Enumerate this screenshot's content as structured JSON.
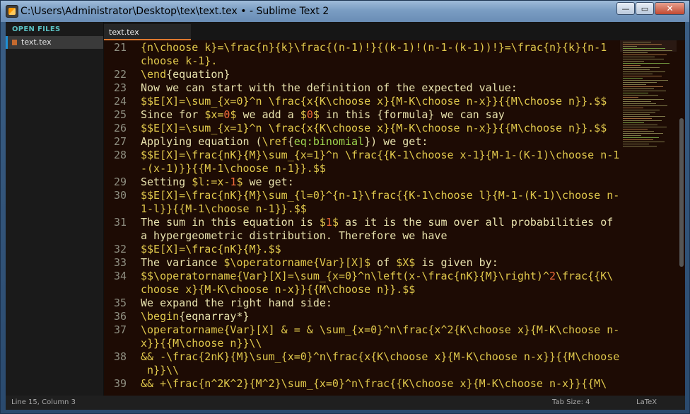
{
  "window": {
    "title": "C:\\Users\\Administrator\\Desktop\\tex\\text.tex • - Sublime Text 2",
    "buttons": {
      "minimize": "—",
      "maximize": "▭",
      "close": "✕"
    }
  },
  "sidebar": {
    "header": "OPEN FILES",
    "files": [
      {
        "name": "text.tex"
      }
    ]
  },
  "tabs": [
    {
      "label": "text.tex",
      "active": true
    }
  ],
  "status": {
    "position": "Line 15, Column 3",
    "tab_size": "Tab Size: 4",
    "syntax": "LaTeX"
  },
  "colors": {
    "editor_bg": "#1d0b04",
    "text": "#e8e2ad",
    "keyword": "#e0c84c",
    "number": "#f06a3a",
    "reference": "#9fd84f",
    "tab_accent": "#e0792f"
  },
  "editor": {
    "lines": [
      {
        "n": "21",
        "segments": [
          {
            "t": "{n\\choose k}=\\frac{n}{k}\\frac{(n-1)!}{(k-1)!(n-1-(k-1))!}=\\frac{n}{k}{n-1",
            "c": "y"
          }
        ]
      },
      {
        "n": "",
        "segments": [
          {
            "t": "choose k-1}.",
            "c": "y"
          }
        ]
      },
      {
        "n": "22",
        "segments": [
          {
            "t": "\\end",
            "c": "y"
          },
          {
            "t": "{equation}",
            "c": "c"
          }
        ]
      },
      {
        "n": "23",
        "segments": [
          {
            "t": "Now we can start with the definition of the expected value:",
            "c": "c"
          }
        ]
      },
      {
        "n": "24",
        "segments": [
          {
            "t": "$$E[X]=\\sum_{x=0}^n \\frac{x{K\\choose x}{M-K\\choose n-x}}{{M\\choose n}}.$$",
            "c": "y"
          }
        ]
      },
      {
        "n": "25",
        "segments": [
          {
            "t": "Since for ",
            "c": "c"
          },
          {
            "t": "$x=",
            "c": "y"
          },
          {
            "t": "0",
            "c": "r"
          },
          {
            "t": "$",
            "c": "y"
          },
          {
            "t": " we add a ",
            "c": "c"
          },
          {
            "t": "$",
            "c": "y"
          },
          {
            "t": "0",
            "c": "r"
          },
          {
            "t": "$",
            "c": "y"
          },
          {
            "t": " in this {formula} we can say",
            "c": "c"
          }
        ]
      },
      {
        "n": "26",
        "segments": [
          {
            "t": "$$E[X]=\\sum_{x=1}^n \\frac{x{K\\choose x}{M-K\\choose n-x}}{{M\\choose n}}.$$",
            "c": "y"
          }
        ]
      },
      {
        "n": "27",
        "segments": [
          {
            "t": "Applying equation (",
            "c": "c"
          },
          {
            "t": "\\ref",
            "c": "y"
          },
          {
            "t": "{",
            "c": "c"
          },
          {
            "t": "eq:binomial",
            "c": "g"
          },
          {
            "t": "}) we get:",
            "c": "c"
          }
        ]
      },
      {
        "n": "28",
        "segments": [
          {
            "t": "$$E[X]=\\frac{nK}{M}\\sum_{x=1}^n \\frac{{K-1\\choose x-1}{M-1-(K-1)\\choose n-1",
            "c": "y"
          }
        ]
      },
      {
        "n": "",
        "segments": [
          {
            "t": "-(x-1)}}{{M-1\\choose n-1}}.$$",
            "c": "y"
          }
        ]
      },
      {
        "n": "29",
        "segments": [
          {
            "t": "Setting ",
            "c": "c"
          },
          {
            "t": "$l:=x-",
            "c": "y"
          },
          {
            "t": "1",
            "c": "r"
          },
          {
            "t": "$",
            "c": "y"
          },
          {
            "t": " we get:",
            "c": "c"
          }
        ]
      },
      {
        "n": "30",
        "segments": [
          {
            "t": "$$E[X]=\\frac{nK}{M}\\sum_{l=0}^{n-1}\\frac{{K-1\\choose l}{M-1-(K-1)\\choose n-",
            "c": "y"
          }
        ]
      },
      {
        "n": "",
        "segments": [
          {
            "t": "1-l}}{{M-1\\choose n-1}}.$$",
            "c": "y"
          }
        ]
      },
      {
        "n": "31",
        "segments": [
          {
            "t": "The sum in this equation is ",
            "c": "c"
          },
          {
            "t": "$",
            "c": "y"
          },
          {
            "t": "1",
            "c": "r"
          },
          {
            "t": "$",
            "c": "y"
          },
          {
            "t": " as it is the sum over all probabilities of",
            "c": "c"
          }
        ]
      },
      {
        "n": "",
        "segments": [
          {
            "t": "a hypergeometric distribution. Therefore we have",
            "c": "c"
          }
        ]
      },
      {
        "n": "32",
        "segments": [
          {
            "t": "$$E[X]=\\frac{nK}{M}.$$",
            "c": "y"
          }
        ]
      },
      {
        "n": "33",
        "segments": [
          {
            "t": "The variance ",
            "c": "c"
          },
          {
            "t": "$\\operatorname{Var}[X]$",
            "c": "y"
          },
          {
            "t": " of ",
            "c": "c"
          },
          {
            "t": "$X$",
            "c": "y"
          },
          {
            "t": " is given by:",
            "c": "c"
          }
        ]
      },
      {
        "n": "34",
        "segments": [
          {
            "t": "$$\\operatorname{Var}[X]=\\sum_{x=0}^n\\left(x-\\frac{nK}{M}\\right)^",
            "c": "y"
          },
          {
            "t": "2",
            "c": "r"
          },
          {
            "t": "\\frac{{K\\",
            "c": "y"
          }
        ]
      },
      {
        "n": "",
        "segments": [
          {
            "t": "choose x}{M-K\\choose n-x}}{{M\\choose n}}.$$",
            "c": "y"
          }
        ]
      },
      {
        "n": "35",
        "segments": [
          {
            "t": "We expand the right hand side:",
            "c": "c"
          }
        ]
      },
      {
        "n": "36",
        "segments": [
          {
            "t": "\\begin",
            "c": "y"
          },
          {
            "t": "{eqnarray*}",
            "c": "c"
          }
        ]
      },
      {
        "n": "37",
        "segments": [
          {
            "t": "\\operatorname{Var}[X] & = & \\sum_{x=0}^n\\frac{x^2{K\\choose x}{M-K\\choose n-",
            "c": "y"
          }
        ]
      },
      {
        "n": "",
        "segments": [
          {
            "t": "x}}{{M\\choose n}}\\\\",
            "c": "y"
          }
        ]
      },
      {
        "n": "38",
        "segments": [
          {
            "t": "&& -\\frac{2nK}{M}\\sum_{x=0}^n\\frac{x{K\\choose x}{M-K\\choose n-x}}{{M\\choose",
            "c": "y"
          }
        ]
      },
      {
        "n": "",
        "segments": [
          {
            "t": " n}}\\\\",
            "c": "y"
          }
        ]
      },
      {
        "n": "39",
        "segments": [
          {
            "t": "&& +\\frac{n^2K^2}{M^2}\\sum_{x=0}^n\\frac{{K\\choose x}{M-K\\choose n-x}}{{M\\",
            "c": "y"
          }
        ]
      }
    ]
  }
}
